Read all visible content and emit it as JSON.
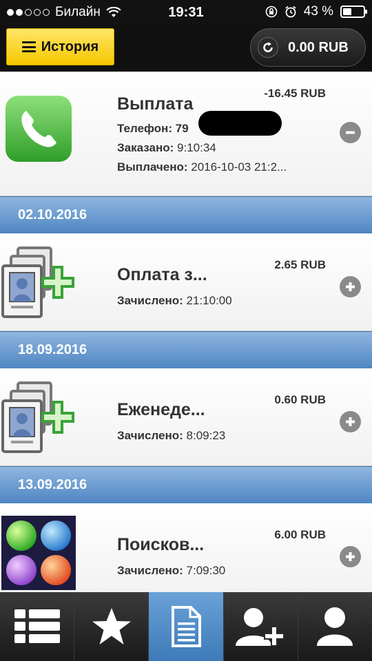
{
  "status_bar": {
    "carrier": "Билайн",
    "time": "19:31",
    "battery": "43 %",
    "battery_level": 0.43
  },
  "toolbar": {
    "history_label": "История",
    "balance": "0.00 RUB"
  },
  "list": [
    {
      "kind": "item",
      "icon": "phone-icon",
      "title": "Выплата",
      "amount": "-16.45 RUB",
      "lines": [
        {
          "label": "Телефон:",
          "value": "79"
        },
        {
          "label": "Заказано:",
          "value": "9:10:34"
        },
        {
          "label": "Выплачено:",
          "value": "2016-10-03 21:2..."
        }
      ],
      "action": "minus-icon"
    },
    {
      "kind": "date",
      "date": "02.10.2016"
    },
    {
      "kind": "item",
      "icon": "add-contacts-icon",
      "title": "Оплата з...",
      "amount": "2.65 RUB",
      "lines": [
        {
          "label": "Зачислено:",
          "value": "21:10:00"
        }
      ],
      "action": "plus-icon"
    },
    {
      "kind": "date",
      "date": "18.09.2016"
    },
    {
      "kind": "item",
      "icon": "add-contacts-icon",
      "title": "Еженеде...",
      "amount": "0.60 RUB",
      "lines": [
        {
          "label": "Зачислено:",
          "value": "8:09:23"
        }
      ],
      "action": "plus-icon"
    },
    {
      "kind": "date",
      "date": "13.09.2016"
    },
    {
      "kind": "item",
      "icon": "color-balls-icon",
      "title": "Поисков...",
      "amount": "6.00 RUB",
      "lines": [
        {
          "label": "Зачислено:",
          "value": "7:09:30"
        }
      ],
      "action": "plus-icon"
    }
  ],
  "tabs": [
    {
      "icon": "list-icon"
    },
    {
      "icon": "star-icon"
    },
    {
      "icon": "document-icon",
      "active": true
    },
    {
      "icon": "add-user-icon"
    },
    {
      "icon": "user-icon"
    }
  ]
}
